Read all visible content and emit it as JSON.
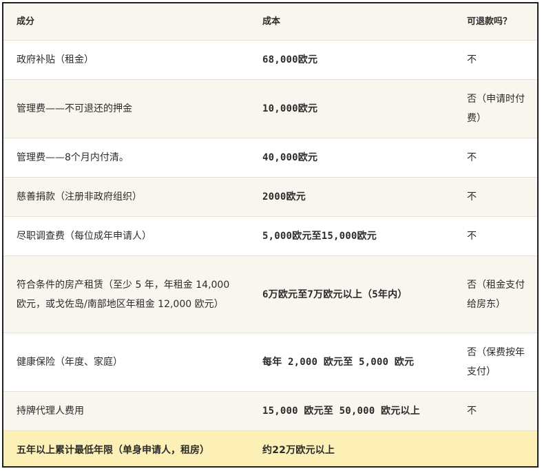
{
  "headers": [
    "成分",
    "成本",
    "可退款吗？"
  ],
  "rows": [
    {
      "item": "政府补贴（租金）",
      "cost": "68,000欧元",
      "refundable": "不"
    },
    {
      "item": "管理费——不可退还的押金",
      "cost": "10,000欧元",
      "refundable": "否（申请时付费）"
    },
    {
      "item": "管理费——8个月内付清。",
      "cost": "40,000欧元",
      "refundable": "不"
    },
    {
      "item": "慈善捐款（注册非政府组织）",
      "cost": "2000欧元",
      "refundable": "不"
    },
    {
      "item": "尽职调查费（每位成年申请人）",
      "cost": "5,000欧元至15,000欧元",
      "refundable": "不"
    },
    {
      "item": "符合条件的房产租赁（至少 5 年，年租金 14,000 欧元，或戈佐岛/南部地区年租金 12,000 欧元）",
      "cost": "6万欧元至7万欧元以上（5年内）",
      "refundable": "否（租金支付给房东）"
    },
    {
      "item": "健康保险（年度、家庭）",
      "cost": "每年 2,000 欧元至 5,000 欧元",
      "refundable": "否（保费按年支付）"
    },
    {
      "item": "持牌代理人费用",
      "cost": "15,000 欧元至 50,000 欧元以上",
      "refundable": "不"
    }
  ],
  "total": {
    "item": "五年以上累计最低年限（单身申请人，租房）",
    "cost": "约22万欧元以上",
    "refundable": ""
  }
}
